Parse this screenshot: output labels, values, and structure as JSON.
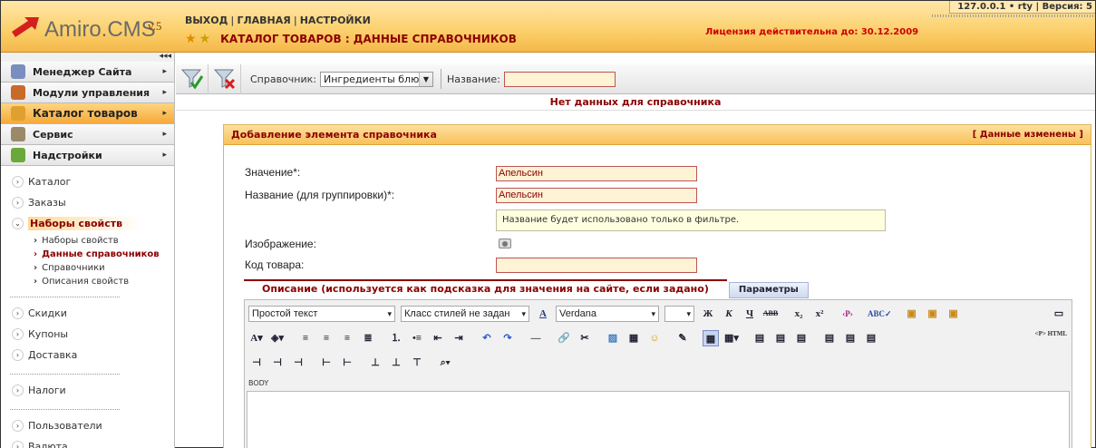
{
  "header": {
    "logo_name": "Amiro.CMS",
    "logo_version": "v.5",
    "nav": [
      "ВЫХОД",
      "ГЛАВНАЯ",
      "НАСТРОЙКИ"
    ],
    "page_title": "КАТАЛОГ ТОВАРОВ : ДАННЫЕ СПРАВОЧНИКОВ",
    "license": "Лицензия действительна до: 30.12.2009",
    "host_info": "127.0.0.1 • rty  |  Версия: 5"
  },
  "sidebar": {
    "collapse_icon": "◂◂◂",
    "menu": [
      {
        "label": "Менеджер Сайта",
        "icon_color": "#7a8fbf"
      },
      {
        "label": "Модули управления",
        "icon_color": "#c86a2a"
      },
      {
        "label": "Каталог товаров",
        "icon_color": "#e0a030"
      },
      {
        "label": "Сервис",
        "icon_color": "#9a8a6a"
      },
      {
        "label": "Надстройки",
        "icon_color": "#6aa83a"
      }
    ],
    "tree_top": [
      "Каталог",
      "Заказы"
    ],
    "tree_open": "Наборы свойств",
    "tree_sub": [
      "Наборы свойств",
      "Данные справочников",
      "Справочники",
      "Описания свойств"
    ],
    "tree_group2": [
      "Скидки",
      "Купоны",
      "Доставка"
    ],
    "tree_group3": [
      "Налоги"
    ],
    "tree_group4": [
      "Пользователи",
      "Валюта"
    ]
  },
  "toolbar": {
    "dict_label": "Справочник:",
    "dict_value": "Ингредиенты блюд",
    "name_label": "Название:",
    "name_value": ""
  },
  "status": {
    "no_data": "Нет данных для справочника"
  },
  "panel": {
    "title": "Добавление элемента справочника",
    "changed": "[ Данные изменены ]",
    "value_label": "Значение*:",
    "value": "Апельсин",
    "group_label": "Название (для группировки)*:",
    "group_value": "Апельсин",
    "hint": "Название будет использовано только в фильтре.",
    "image_label": "Изображение:",
    "code_label": "Код товара:",
    "code_value": "",
    "tab_description": "Описание (используется как подсказка для значения на сайте, если задано)",
    "tab_params": "Параметры"
  },
  "editor": {
    "format_select": "Простой текст",
    "style_select": "Класс стилей не задан",
    "font_select": "Verdana",
    "size_select": "",
    "body_label": "BODY",
    "html_label": "<P> HTML"
  }
}
